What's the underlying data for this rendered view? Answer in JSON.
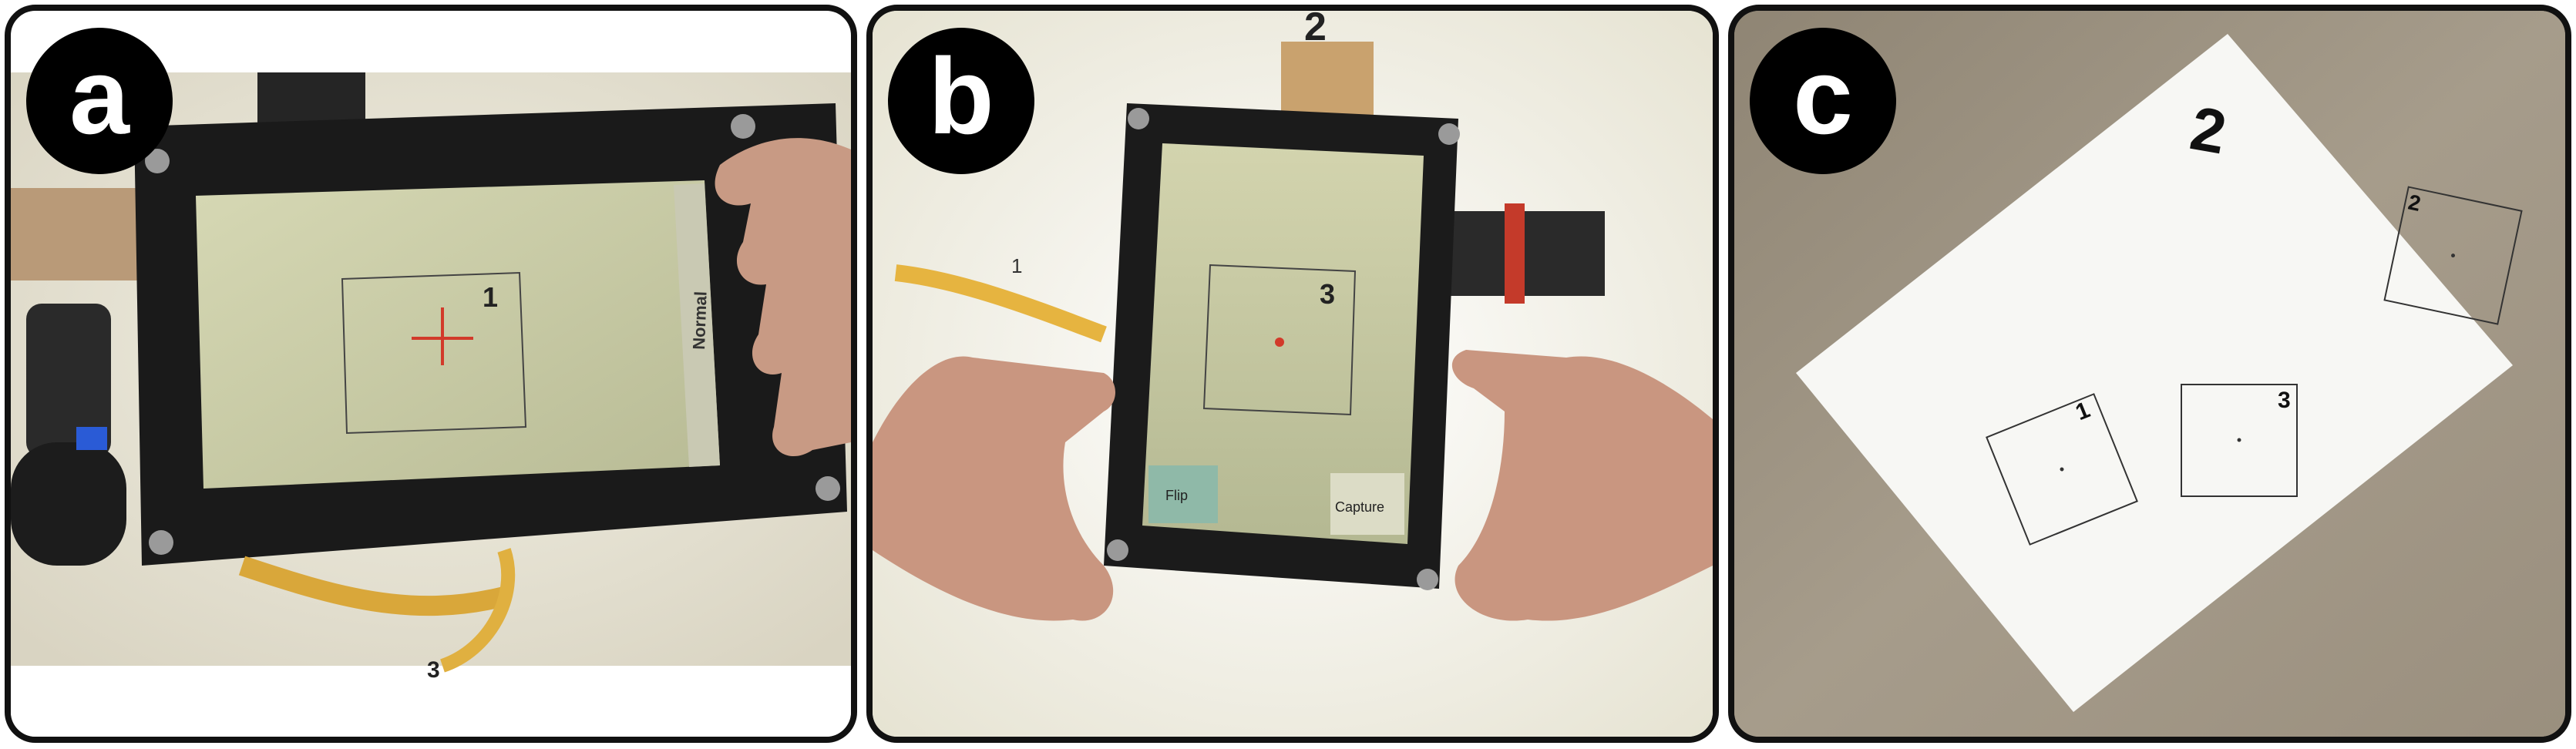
{
  "panels": [
    {
      "label": "a",
      "screen": {
        "marker_number": "1",
        "side_button": "Normal"
      },
      "paper_number": "3"
    },
    {
      "label": "b",
      "screen": {
        "marker_number": "3",
        "button_left": "Flip",
        "button_right": "Capture"
      },
      "cable_number": "1",
      "clip_number": "2"
    },
    {
      "label": "c",
      "sheet_number": "2",
      "squares": [
        {
          "number": "1"
        },
        {
          "number": "2"
        },
        {
          "number": "3"
        }
      ]
    }
  ],
  "colors": {
    "frame": "#111111",
    "screen_tint": "#c8caa4",
    "crosshair": "#d23a2a",
    "paper": "#f7f7f4",
    "table": "#9c9282"
  }
}
